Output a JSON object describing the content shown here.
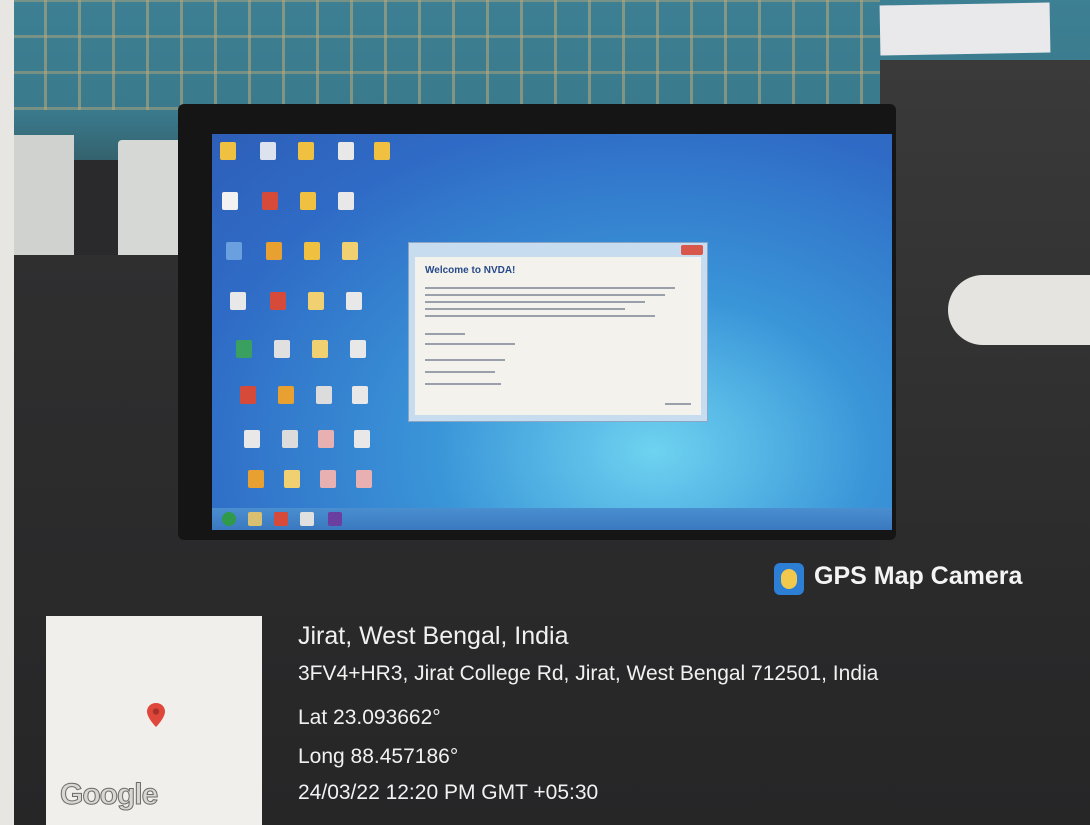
{
  "screen_content": {
    "dialog_title": "Welcome to NVDA!"
  },
  "overlay": {
    "app_name": "GPS Map Camera",
    "location_title": "Jirat, West Bengal, India",
    "address": "3FV4+HR3, Jirat College Rd, Jirat, West Bengal 712501, India",
    "latitude": "Lat 23.093662°",
    "longitude": "Long 88.457186°",
    "datetime": "24/03/22 12:20 PM GMT +05:30",
    "map_brand": "Google"
  },
  "colors": {
    "pin": "#e0473b",
    "badge": "#2d7fd6"
  }
}
